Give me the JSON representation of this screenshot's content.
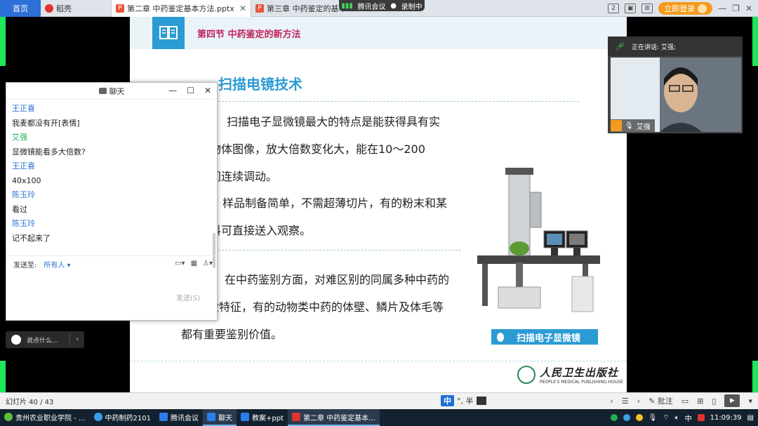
{
  "tabs": {
    "home": "首页",
    "daoke": "稻壳",
    "tab1": "第二章 中药鉴定基本方法.pptx",
    "tab2": "第三章 中药鉴定的基本",
    "close": "✕"
  },
  "meeting": {
    "app": "腾讯会议",
    "record": "录制中"
  },
  "topbar": {
    "login": "立即登录",
    "page_ic": "2"
  },
  "slide": {
    "section": "第四节  中药鉴定的新方法",
    "title": "扫描电镜技术",
    "para1": [
      "扫描电子显微镜最大的特点是能获得具有实",
      "维物体图像，放大倍数变化大，能在10～200",
      "之间连续调动。"
    ],
    "para2": [
      "样品制备简单，不需超薄切片，有的粉末和某",
      "材料可直接送入观察。"
    ],
    "para3": [
      "在中药鉴别方面，对难区别的同属多种中药的",
      "微特征，有的动物类中药的体壁、鳞片及体毛等",
      "都有重要鉴别价值。"
    ],
    "caption": "扫描电子显微镜",
    "publisher_cn": "人民卫生出版社",
    "publisher_en": "PEOPLE'S MEDICAL PUBLISHING HOUSE"
  },
  "chat": {
    "title": "聊天",
    "messages": [
      {
        "name": "王正喜",
        "text": "我麦都没有开[表情]",
        "color": "#2d73d8"
      },
      {
        "name": "艾强",
        "text": "显微镜能看多大倍数?",
        "color": "#1fb14f"
      },
      {
        "name": "王正喜",
        "text": "40x100",
        "color": "#2d73d8"
      },
      {
        "name": "陈玉玲",
        "text": "看过",
        "color": "#2d73d8"
      },
      {
        "name": "陈玉玲",
        "text": "记不起来了",
        "color": "#2d73d8"
      }
    ],
    "send_to_label": "发送至:",
    "send_to_value": "所有人",
    "send_button": "发送(S)",
    "say_something": "说点什么..."
  },
  "video": {
    "speaking": "正在讲话: 艾强;",
    "name": "艾强"
  },
  "statusbar": {
    "slide_counter": "幻灯片 40 / 43",
    "ime": "中",
    "ime_extra": "°, 半",
    "notes": "批注"
  },
  "taskbar": {
    "items": [
      "贵州农业职业学院 - ...",
      "中药制药2101",
      "腾讯会议",
      "聊天",
      "教案+ppt",
      "第二章 中药鉴定基本..."
    ],
    "time": "11:09:39",
    "lang": "中"
  }
}
